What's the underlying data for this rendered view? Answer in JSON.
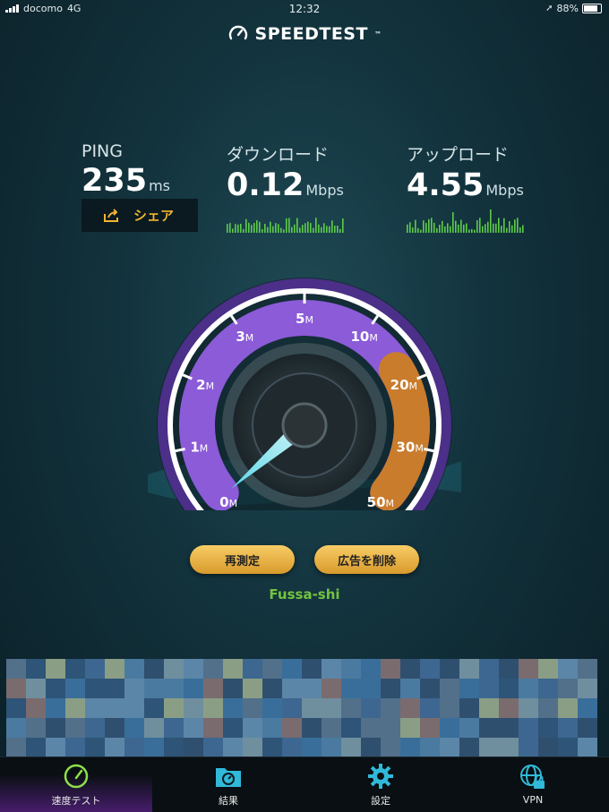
{
  "status": {
    "carrier": "docomo",
    "network": "4G",
    "time": "12:32",
    "battery": "88%"
  },
  "app": {
    "title": "SPEEDTEST",
    "tm": "™"
  },
  "results": {
    "ping": {
      "label": "PING",
      "value": "235",
      "unit": "ms"
    },
    "download": {
      "label": "ダウンロード",
      "value": "0.12",
      "unit": "Mbps"
    },
    "upload": {
      "label": "アップロード",
      "value": "4.55",
      "unit": "Mbps"
    }
  },
  "share_label": "シェア",
  "gauge": {
    "ticks": [
      {
        "n": "0",
        "u": "M"
      },
      {
        "n": "1",
        "u": "M"
      },
      {
        "n": "2",
        "u": "M"
      },
      {
        "n": "3",
        "u": "M"
      },
      {
        "n": "5",
        "u": "M"
      },
      {
        "n": "10",
        "u": "M"
      },
      {
        "n": "20",
        "u": "M"
      },
      {
        "n": "30",
        "u": "M"
      },
      {
        "n": "50",
        "u": "M"
      }
    ],
    "needle_value_mbps": 0.12
  },
  "buttons": {
    "retest": "再測定",
    "remove_ads": "広告を削除"
  },
  "location": "Fussa-shi",
  "tabs": [
    {
      "label": "速度テスト",
      "icon": "speedometer-icon",
      "active": true
    },
    {
      "label": "結果",
      "icon": "results-folder-icon",
      "active": false
    },
    {
      "label": "設定",
      "icon": "gear-icon",
      "active": false
    },
    {
      "label": "VPN",
      "icon": "vpn-globe-lock-icon",
      "active": false
    }
  ],
  "colors": {
    "accent_orange": "#f2b530",
    "gauge_purple": "#8c5bd8",
    "location_green": "#72c43f",
    "spark_green": "#5ecb4a"
  }
}
